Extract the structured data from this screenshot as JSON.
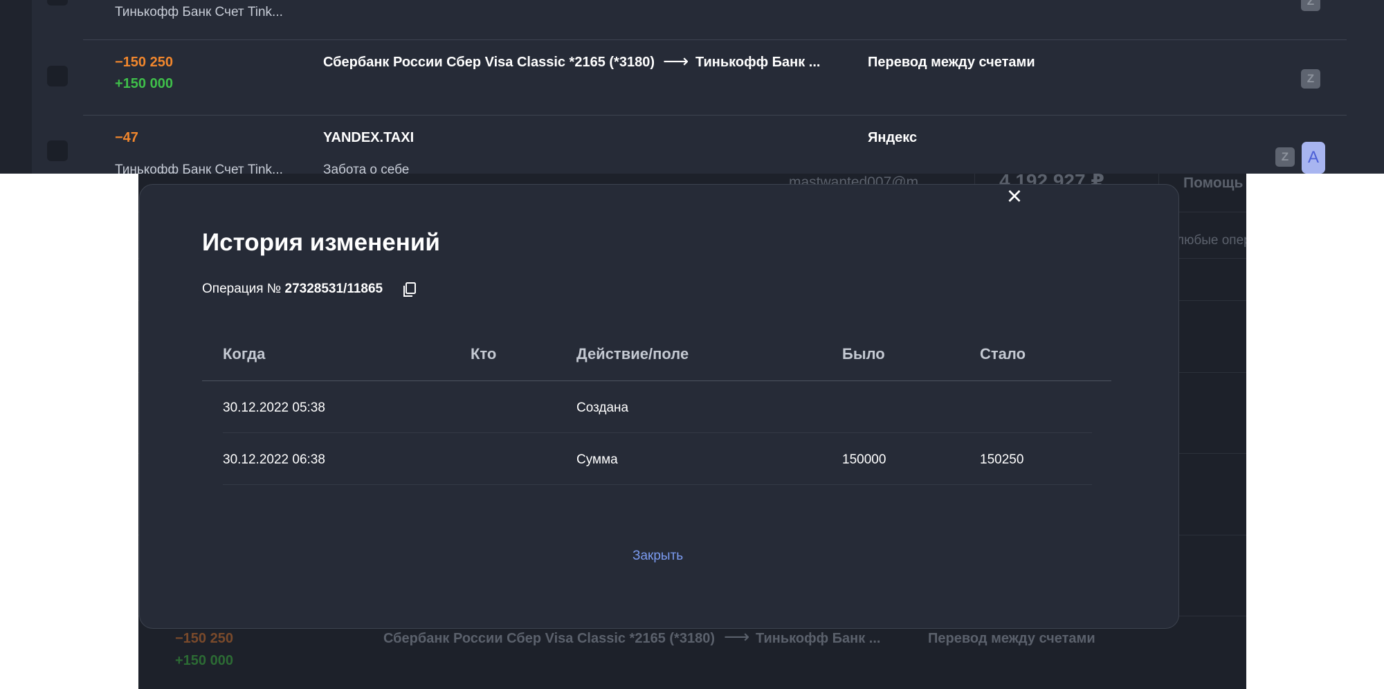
{
  "top_list": {
    "row0_account": "Тинькофф Банк Счет Tink...",
    "row1": {
      "amount_neg": "−150 250",
      "amount_pos": "+150 000",
      "from_account": "Сбербанк России Сбер Visa Classic *2165 (*3180)",
      "arrow": "⟶",
      "to_account": "Тинькофф Банк ...",
      "category": "Перевод между счетами"
    },
    "row2": {
      "amount_neg": "−47",
      "merchant": "YANDEX.TAXI",
      "category": "Яндекс",
      "account": "Тинькофф Банк Счет Tink...",
      "subcategory": "Забота о себе"
    },
    "tag_z": "Z",
    "tag_a": "A"
  },
  "background": {
    "email_fragment": "mastwanted007@m",
    "balance_fragment": "4 192 927 ₽",
    "help_fragment": "Помощь",
    "filter_fragment": "любые опер",
    "row": {
      "amount_neg": "−150 250",
      "amount_pos": "+150 000",
      "from_account": "Сбербанк России Сбер Visa Classic *2165 (*3180)",
      "arrow": "⟶",
      "to_account": "Тинькофф Банк ...",
      "category": "Перевод между счетами"
    }
  },
  "modal": {
    "close_icon": "×",
    "title": "История изменений",
    "operation_label": "Операция №",
    "operation_number": "27328531/11865",
    "columns": [
      "Когда",
      "Кто",
      "Действие/поле",
      "Было",
      "Стало"
    ],
    "rows": [
      {
        "when": "30.12.2022 05:38",
        "who": "",
        "action": "Создана",
        "was": "",
        "became": ""
      },
      {
        "when": "30.12.2022 06:38",
        "who": "",
        "action": "Сумма",
        "was": "150000",
        "became": "150250"
      }
    ],
    "close_label": "Закрыть"
  },
  "colors": {
    "panel_bg": "#262b37",
    "negative": "#f2872d",
    "positive": "#3fbf4a",
    "link": "#7b9bf0"
  }
}
